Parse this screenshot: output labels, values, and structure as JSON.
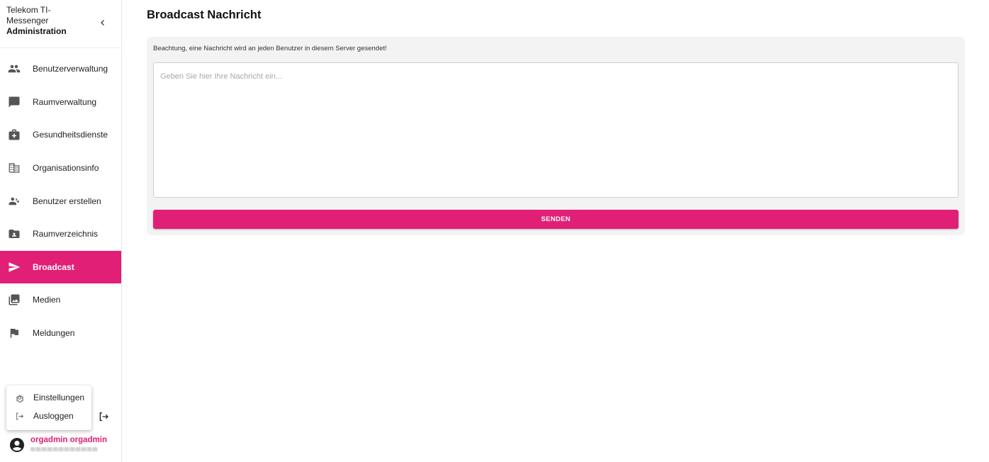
{
  "brand": {
    "line1": "Telekom TI-",
    "line2": "Messenger",
    "line3": "Administration"
  },
  "sidebar": {
    "items": [
      {
        "label": "Benutzerverwaltung",
        "icon": "people-icon"
      },
      {
        "label": "Raumverwaltung",
        "icon": "chat-icon"
      },
      {
        "label": "Gesundheitsdienste",
        "icon": "medical-bag-icon"
      },
      {
        "label": "Organisationsinfo",
        "icon": "building-icon"
      },
      {
        "label": "Benutzer erstellen",
        "icon": "person-add-icon"
      },
      {
        "label": "Raumverzeichnis",
        "icon": "contact-folder-icon"
      },
      {
        "label": "Broadcast",
        "icon": "send-icon",
        "active": true
      },
      {
        "label": "Medien",
        "icon": "photo-library-icon"
      },
      {
        "label": "Meldungen",
        "icon": "flag-icon"
      }
    ]
  },
  "user_menu": {
    "settings_label": "Einstellungen",
    "logout_label": "Ausloggen"
  },
  "user": {
    "name": "orgadmin orgadmin"
  },
  "main": {
    "title": "Broadcast Nachricht",
    "notice": "Beachtung, eine Nachricht wird an jeden Benutzer in diesem Server gesendet!",
    "message_placeholder": "Geben Sie hier Ihre Nachricht ein...",
    "message_value": "",
    "send_label": "SENDEN"
  },
  "colors": {
    "accent": "#e21f76",
    "sidebar_bg": "#ffffff",
    "card_bg": "#f3f3f3"
  }
}
